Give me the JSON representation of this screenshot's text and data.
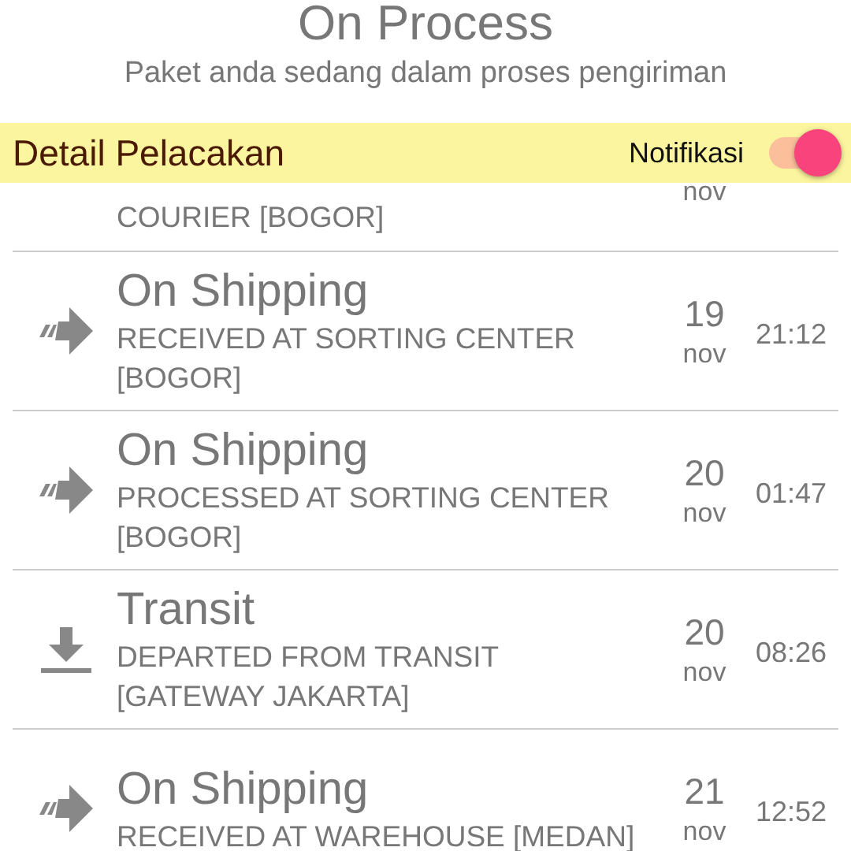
{
  "header": {
    "title": "On Process",
    "subtitle": "Paket anda sedang dalam proses pengiriman"
  },
  "bar": {
    "title": "Detail Pelacakan",
    "toggle_label": "Notifikasi",
    "toggle_on": true
  },
  "events": [
    {
      "description": "COURIER [BOGOR]",
      "month": "nov"
    },
    {
      "kind": "shipping",
      "status": "On Shipping",
      "description": "RECEIVED AT SORTING CENTER [BOGOR]",
      "day": "19",
      "month": "nov",
      "time": "21:12"
    },
    {
      "kind": "shipping",
      "status": "On Shipping",
      "description": "PROCESSED AT SORTING CENTER [BOGOR]",
      "day": "20",
      "month": "nov",
      "time": "01:47"
    },
    {
      "kind": "transit",
      "status": "Transit",
      "description": "DEPARTED FROM TRANSIT [GATEWAY JAKARTA]",
      "day": "20",
      "month": "nov",
      "time": "08:26"
    },
    {
      "kind": "shipping",
      "status": "On Shipping",
      "description": "RECEIVED AT WAREHOUSE [MEDAN]",
      "day": "21",
      "month": "nov",
      "time": "12:52"
    }
  ]
}
